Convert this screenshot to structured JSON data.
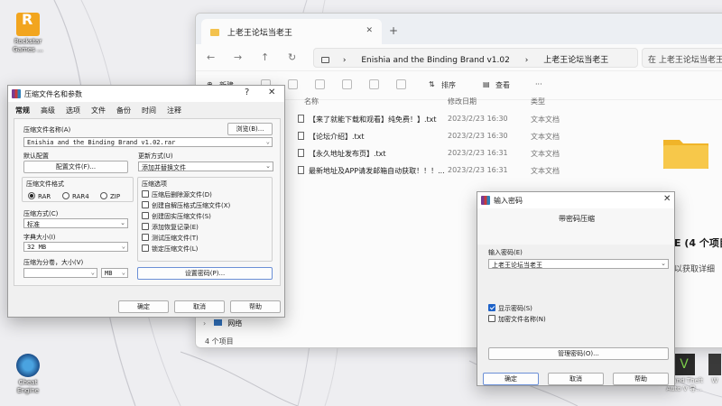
{
  "desktop": {
    "icons": [
      {
        "name": "Rockstar Games ...",
        "icon": "rockstar-icon"
      },
      {
        "name": "Cheat Engine",
        "icon": "cheat-engine-icon"
      }
    ],
    "right_icons": [
      {
        "label": "Grand Theft Auto V 导...",
        "icon": "gta-v-icon"
      },
      {
        "label": "W",
        "icon": "app-icon"
      }
    ]
  },
  "explorer": {
    "tab_title": "上老王论坛当老王",
    "path": [
      "Enishia and the Binding Brand v1.02",
      "上老王论坛当老王"
    ],
    "search_placeholder": "在 上老王论坛当老王 中搜索",
    "toolbar": {
      "new": "新建",
      "sort": "排序",
      "view": "查看",
      "more": "···"
    },
    "columns": {
      "name": "名称",
      "modified": "修改日期",
      "type": "类型"
    },
    "files": [
      {
        "name": "【来了就能下载和观看】纯免费！】.txt",
        "date": "2023/2/23 16:30",
        "type": "文本文档"
      },
      {
        "name": "【论坛介绍】.txt",
        "date": "2023/2/23 16:30",
        "type": "文本文档"
      },
      {
        "name": "【永久地址发布页】.txt",
        "date": "2023/2/23 16:31",
        "type": "文本文档"
      },
      {
        "name": "最新地址及APP请发邮箱自动获取！！！...",
        "date": "2023/2/23 16:31",
        "type": "文本文档"
      }
    ],
    "details": {
      "count_text": "E (4 个项目",
      "hint_text": "以获取详细"
    },
    "nav_network": "网络",
    "status": "4 个项目"
  },
  "archive_dialog": {
    "title": "压缩文件名和参数",
    "help_char": "?",
    "tabs": [
      "常规",
      "高级",
      "选项",
      "文件",
      "备份",
      "时间",
      "注释"
    ],
    "filename_label": "压缩文件名称(A)",
    "browse": "浏览(B)...",
    "filename_value": "Enishia and the Binding Brand v1.02.rar",
    "default_profile_label": "默认配置",
    "profiles_button": "配置文件(F)...",
    "update_mode_label": "更新方式(U)",
    "update_mode_value": "添加并替换文件",
    "format_group": "压缩文件格式",
    "formats": [
      "RAR",
      "RAR4",
      "ZIP"
    ],
    "selected_format": "RAR",
    "method_label": "压缩方式(C)",
    "method_value": "标准",
    "dict_label": "字典大小(I)",
    "dict_value": "32 MB",
    "split_label": "压缩为分卷，大小(V)",
    "split_unit": "MB",
    "options_group": "压缩选项",
    "options": [
      "压缩后删除源文件(D)",
      "创建自解压格式压缩文件(X)",
      "创建固实压缩文件(S)",
      "添加恢复记录(E)",
      "测试压缩文件(T)",
      "锁定压缩文件(L)"
    ],
    "set_password": "设置密码(P)...",
    "ok": "确定",
    "cancel": "取消",
    "help": "帮助"
  },
  "password_dialog": {
    "title": "输入密码",
    "heading": "带密码压缩",
    "enter_label": "输入密码(E)",
    "password_value": "上老王论坛当老王",
    "show_password": "显示密码(S)",
    "show_password_checked": true,
    "encrypt_names": "加密文件名称(N)",
    "encrypt_names_checked": false,
    "manage": "管理密码(O)...",
    "ok": "确定",
    "cancel": "取消",
    "help": "帮助"
  }
}
